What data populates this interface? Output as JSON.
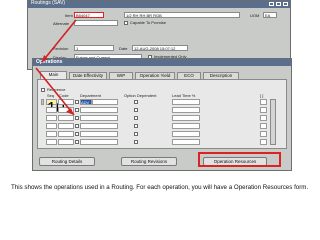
{
  "routing_window": {
    "title": "Routings (SAV)",
    "item_label": "Item",
    "item_value": "B54047",
    "item_desc": "1/2 RH RH BR RGB",
    "uom_label": "UOM",
    "uom_value": "EA",
    "alternate_label": "Alternate",
    "capable_label": "Capable To Promise",
    "revision_label": "Revision",
    "revision_value": "1",
    "date_label": "Date",
    "date_value": "12-AUG-2008 15:07:12",
    "display_label": "Display",
    "display_value": "Future and Current",
    "implemented_label": "Implemented Only"
  },
  "operations_window": {
    "title": "Operations",
    "tabs": [
      "Main",
      "Date Effectivity",
      "WIP",
      "Operation Yield",
      "ECO",
      "Description"
    ],
    "reference_label": "Reference",
    "columns": [
      "Seq",
      "Code",
      "Department",
      "Option Dependent",
      "Lead Time %"
    ],
    "row1": {
      "seq": "10",
      "department": "ADV"
    },
    "buttons": [
      "Routing Details",
      "Routing Revisions",
      "Operation Resources"
    ]
  },
  "caption": "This shows the operations used in a Routing.  For each operation, you will have a Operation Resources form.",
  "colors": {
    "title_bar": "#5a6f8e",
    "highlight": "#d22222",
    "selected_field": "#f7f4a0"
  }
}
